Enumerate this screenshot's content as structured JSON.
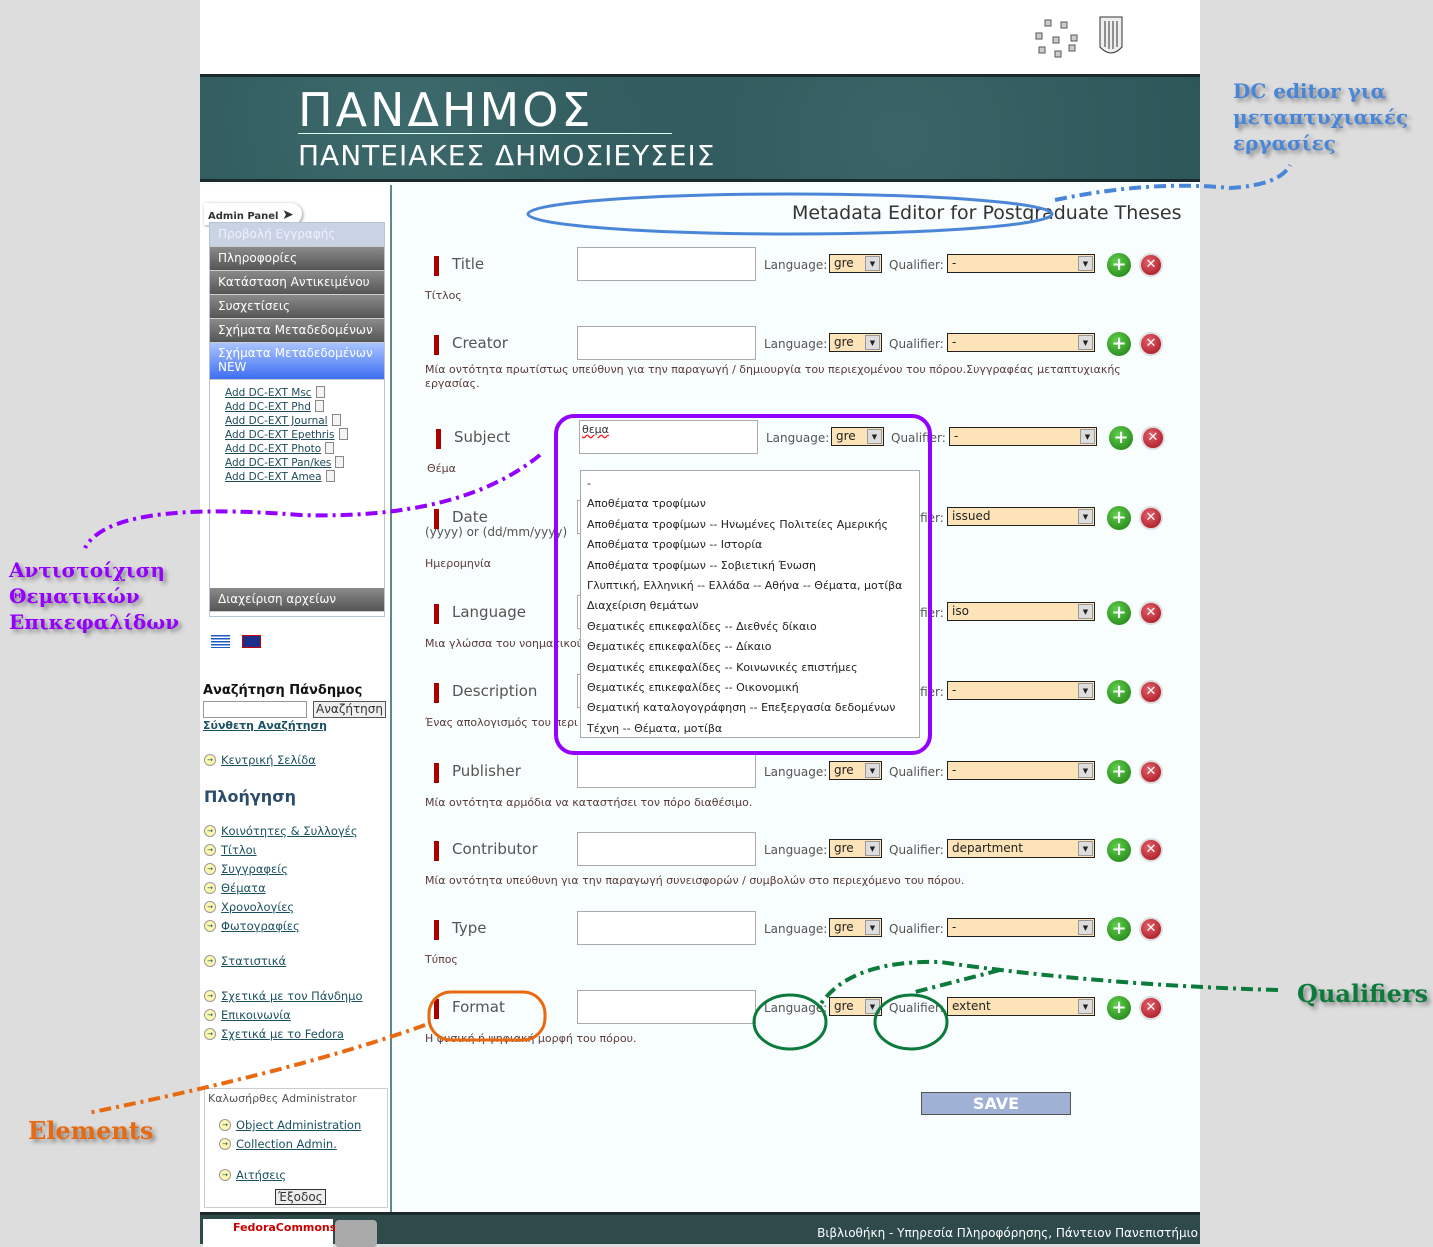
{
  "banner": {
    "title": "ΠΑΝΔΗΜΟΣ",
    "subtitle": "ΠΑΝΤΕΙΑΚΕΣ ΔΗΜΟΣΙΕΥΣΕΙΣ"
  },
  "page_title": "Metadata Editor for Postgraduate Theses",
  "sidebar": {
    "admin_panel": "Admin Panel",
    "menu": [
      "Προβολή Εγγραφής",
      "Πληροφορίες",
      "Κατάσταση Αντικειμένου",
      "Συσχετίσεις",
      "Σχήματα Μεταδεδομένων"
    ],
    "menu_active": "Σχήματα Μεταδεδομένων NEW",
    "add_links": [
      "Add DC-EXT Msc",
      "Add DC-EXT Phd",
      "Add DC-EXT Journal",
      "Add DC-EXT Epethris",
      "Add DC-EXT Photo",
      "Add DC-EXT Pan/kes",
      "Add DC-EXT Amea"
    ],
    "file_management": "Διαχείριση αρχείων",
    "search_heading": "Αναζήτηση Πάνδημος",
    "search_button": "Αναζήτηση",
    "advanced_search": "Σύνθετη Αναζήτηση",
    "home": "Κεντρική Σελίδα",
    "nav_heading": "Πλοήγηση",
    "nav": [
      "Κοινότητες & Συλλογές",
      "Τίτλοι",
      "Συγγραφείς",
      "Θέματα",
      "Χρονολογίες",
      "Φωτογραφίες"
    ],
    "stats": "Στατιστικά",
    "about": [
      "Σχετικά με τον Πάνδημο",
      "Επικοινωνία",
      "Σχετικά με το Fedora"
    ],
    "welcome": "Καλωσήρθες Administrator",
    "admin_links": [
      "Object Administration",
      "Collection Admin."
    ],
    "requests": "Αιτήσεις",
    "logout": "Έξοδος"
  },
  "form": {
    "language_label": "Language:",
    "qualifier_label": "Qualifier:",
    "rows": [
      {
        "element": "Title",
        "desc": "Τίτλος",
        "value": "",
        "lang": "gre",
        "qualifier": "-"
      },
      {
        "element": "Creator",
        "desc": "Μία οντότητα πρωτίστως υπεύθυνη για την παραγωγή / δημιουργία του περιεχομένου του πόρου.Συγγραφέας μεταπτυχιακής εργασίας.",
        "value": "",
        "lang": "gre",
        "qualifier": "-"
      },
      {
        "element": "Subject",
        "desc": "Θέμα",
        "value": "θεμα",
        "lang": "gre",
        "qualifier": "-"
      },
      {
        "element": "Date",
        "hint": "(yyyy) or (dd/mm/yyyy)",
        "desc": "Ημερομηνία",
        "value": "",
        "lang": "",
        "qualifier": "issued"
      },
      {
        "element": "Language",
        "desc": "Μια γλώσσα του νοηματικού",
        "value": "",
        "lang": "",
        "qualifier": "iso"
      },
      {
        "element": "Description",
        "desc": "Ένας απολογισμός του περι",
        "value": "",
        "lang": "",
        "qualifier": "-"
      },
      {
        "element": "Publisher",
        "desc": "Μία οντότητα αρμόδια να καταστήσει τον πόρο διαθέσιμο.",
        "value": "",
        "lang": "gre",
        "qualifier": "-"
      },
      {
        "element": "Contributor",
        "desc": "Μία οντότητα υπεύθυνη για την παραγωγή συνεισφορών / συμβολών στο περιεχόμενο του πόρου.",
        "value": "",
        "lang": "gre",
        "qualifier": "department"
      },
      {
        "element": "Type",
        "desc": "Τύπος",
        "value": "",
        "lang": "gre",
        "qualifier": "-"
      },
      {
        "element": "Format",
        "desc": "Η φυσική ή ψηφιακή μορφή του πόρου.",
        "value": "",
        "lang": "gre",
        "qualifier": "extent"
      }
    ],
    "subject_suggestions": [
      "-",
      "Αποθέματα τροφίμων",
      "Αποθέματα τροφίμων -- Ηνωμένες Πολιτείες Αμερικής",
      "Αποθέματα τροφίμων -- Ιστορία",
      "Αποθέματα τροφίμων -- Σοβιετική Ένωση",
      "Γλυπτική, Ελληνική -- Ελλάδα -- Αθήνα -- Θέματα, μοτίβα",
      "Διαχείριση θεμάτων",
      "Θεματικές επικεφαλίδες -- Διεθνές δίκαιο",
      "Θεματικές επικεφαλίδες -- Δίκαιο",
      "Θεματικές επικεφαλίδες -- Κοινωνικές επιστήμες",
      "Θεματικές επικεφαλίδες -- Οικονομική",
      "Θεματική καταλογογράφηση -- Επεξεργασία δεδομένων",
      "Τέχνη -- Θέματα, μοτίβα"
    ],
    "save": "SAVE"
  },
  "footer": {
    "fedora": "FedoraCommons",
    "text": "Βιβλιοθήκη - Υπηρεσία Πληροφόρησης, Πάντειον Πανεπιστήμιο"
  },
  "annotations": {
    "dc_editor": "DC editor για μεταπτυχιακές εργασίες",
    "subject_headings": "Αντιστοίχιση Θεματικών Επικεφαλίδων",
    "qualifiers": "Qualifiers",
    "elements": "Elements"
  },
  "colors": {
    "banner": "#2d5659",
    "select_bg": "#fde4b8",
    "element_marker": "#aa0000",
    "annot_blue": "#4a86d8",
    "annot_purple": "#9400ff",
    "annot_green": "#0c7a3a",
    "annot_orange": "#e86a10"
  }
}
